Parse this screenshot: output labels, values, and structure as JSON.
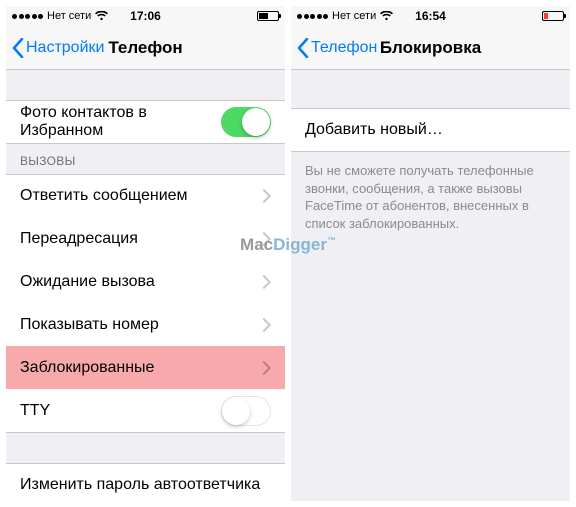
{
  "watermark": {
    "part1": "Mac",
    "part2": "Digger",
    "tm": "™"
  },
  "left": {
    "status": {
      "carrier": "Нет сети",
      "time": "17:06"
    },
    "nav": {
      "back": "Настройки",
      "title": "Телефон"
    },
    "rows": {
      "favorites_photos": "Фото контактов в Избранном",
      "group_calls": "ВЫЗОВЫ",
      "respond_text": "Ответить сообщением",
      "forwarding": "Переадресация",
      "call_waiting": "Ожидание вызова",
      "show_caller_id": "Показывать номер",
      "blocked": "Заблокированные",
      "tty": "TTY",
      "change_vm_pwd": "Изменить пароль автоответчика"
    }
  },
  "right": {
    "status": {
      "carrier": "Нет сети",
      "time": "16:54"
    },
    "nav": {
      "back": "Телефон",
      "title": "Блокировка"
    },
    "rows": {
      "add_new": "Добавить новый…"
    },
    "footer": "Вы не сможете получать телефонные звонки, сообщения, а также вызовы FaceTime от абонентов, внесенных в список заблокированных."
  }
}
